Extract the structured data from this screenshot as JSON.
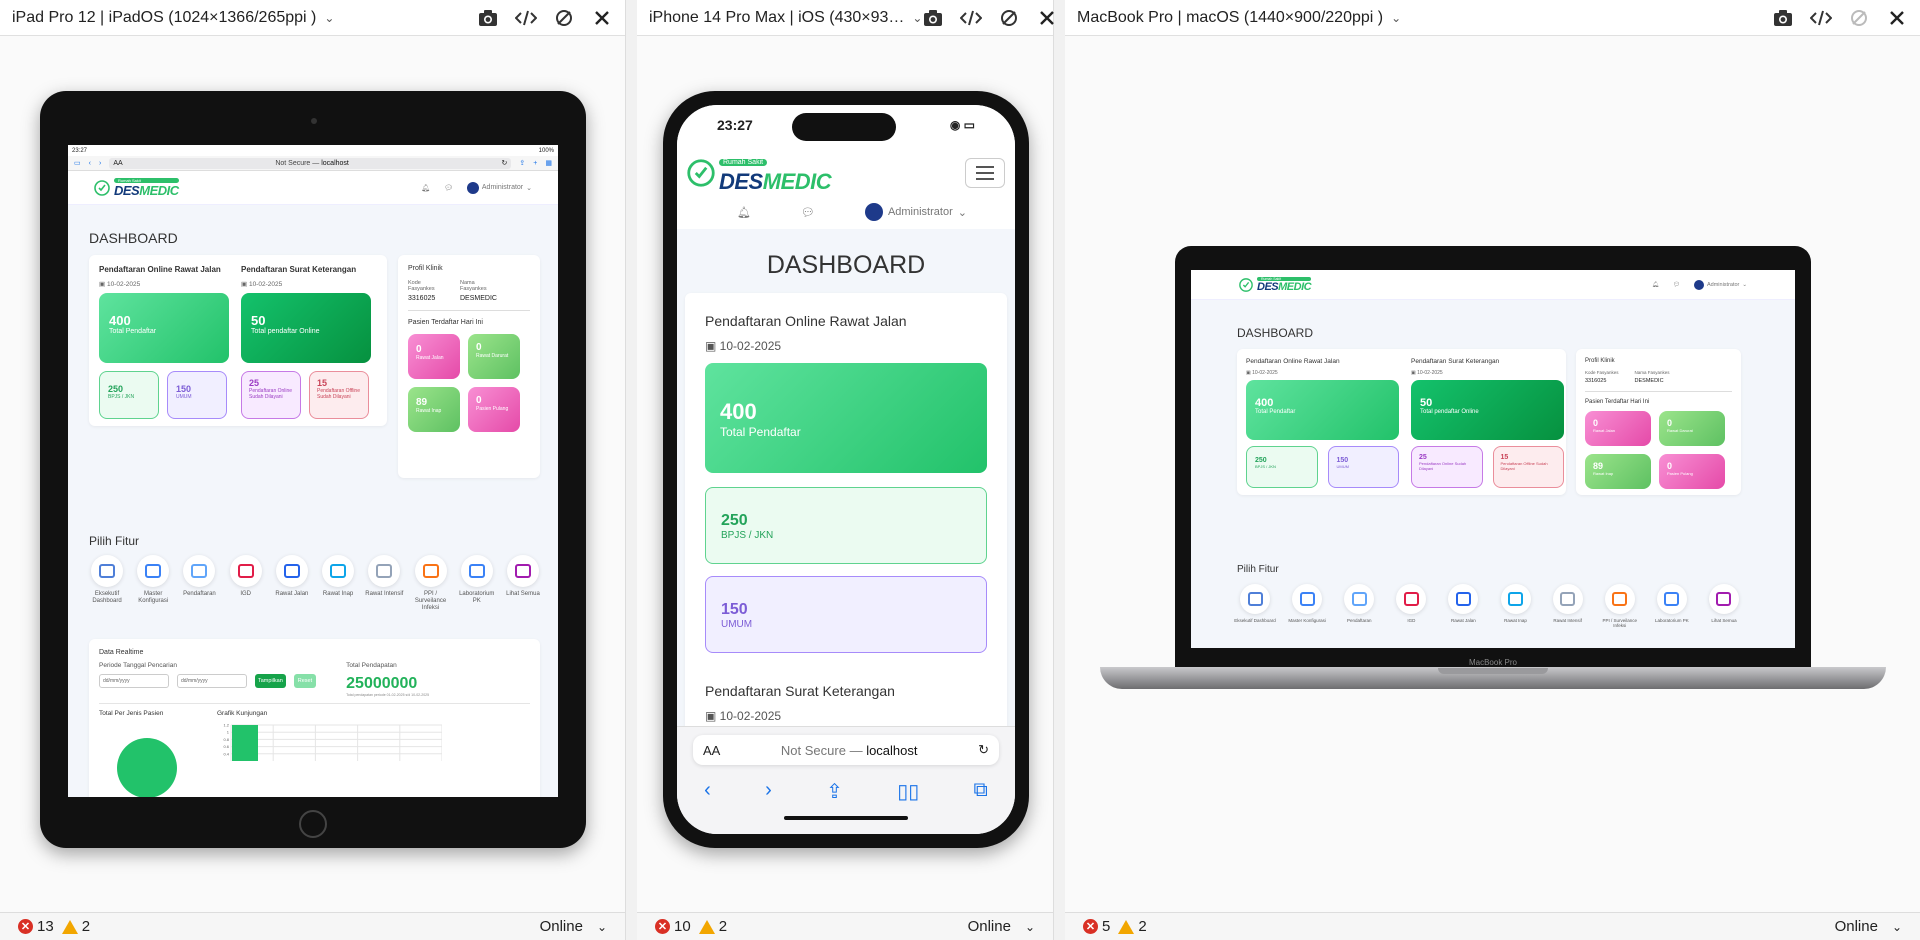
{
  "panes": [
    {
      "title": "iPad Pro 12 | iPadOS (1024×1366/265ppi )",
      "errors": "13",
      "warnings": "2",
      "status": "Online"
    },
    {
      "title": "iPhone 14 Pro Max | iOS (430×93…",
      "errors": "10",
      "warnings": "2",
      "status": "Online"
    },
    {
      "title": "MacBook Pro | macOS (1440×900/220ppi )",
      "errors": "5",
      "warnings": "2",
      "status": "Online"
    }
  ],
  "app": {
    "logo_badge": "Rumah Sakit",
    "logo_main": "DES",
    "logo_accent": "MEDIC",
    "user": "Administrator",
    "page_title": "DASHBOARD",
    "online_title": "Pendaftaran Online Rawat Jalan",
    "online_date": "10-02-2025",
    "online_total": "400",
    "online_total_label": "Total Pendaftar",
    "bpjs_value": "250",
    "bpjs_label": "BPJS / JKN",
    "umum_value": "150",
    "umum_label": "UMUM",
    "surat_title": "Pendaftaran Surat Keterangan",
    "surat_date": "10-02-2025",
    "surat_total": "50",
    "surat_total_label": "Total pendaftar Online",
    "surat_online_done": "25",
    "surat_online_done_label": "Pendaftaran Online Sudah Dilayani",
    "surat_offline_done": "15",
    "surat_offline_done_label": "Pendaftaran Offline Sudah Dilayani",
    "profil_title": "Profil Klinik",
    "kode_label": "Kode Fasyankes",
    "kode_value": "3316025",
    "nama_label": "Nama Fasyankes",
    "nama_value": "DESMEDIC",
    "pasien_title": "Pasien Terdaftar Hari Ini",
    "rawat_jalan": "0",
    "rawat_jalan_label": "Rawat Jalan",
    "rawat_darurat": "0",
    "rawat_darurat_label": "Rawat Darurat",
    "rawat_inap": "89",
    "rawat_inap_label": "Rawat Inap",
    "pasien_pulang": "0",
    "pasien_pulang_label": "Pasien Pulang",
    "fitur_title": "Pilih Fitur",
    "features": [
      "Eksekutif Dashboard",
      "Master Konfigurasi",
      "Pendaftaran",
      "IGD",
      "Rawat Jalan",
      "Rawat Inap",
      "Rawat Intensif",
      "PPI / Surveilance Infeksi",
      "Laboratorium PK",
      "Lihat Semua"
    ],
    "realtime_title": "Data Realtime",
    "periode_label": "Periode Tanggal Pencarian",
    "date_placeholder": "dd/mm/yyyy",
    "btn_tampilkan": "Tampilkan",
    "btn_reset": "Reset",
    "total_pendapatan_label": "Total Pendapatan",
    "total_pendapatan": "25000000",
    "total_pendapatan_note": "Total pendapatan periode 01-02-2025 s/d 10-02-2025",
    "jenis_pasien_title": "Total Per Jenis Pasien",
    "kunjungan_title": "Grafik Kunjungan"
  },
  "ipad_browser": {
    "time": "23:27",
    "battery": "100%",
    "aa": "AA",
    "url_prefix": "Not Secure — ",
    "url_host": "localhost"
  },
  "iphone": {
    "time": "23:27",
    "aa": "AA",
    "url_prefix": "Not Secure — ",
    "url_host": "localhost"
  },
  "macbook": {
    "brand": "MacBook Pro"
  },
  "chart_data": {
    "type": "bar",
    "title": "Grafik Kunjungan",
    "yticks": [
      "1.2",
      "1",
      "0.8",
      "0.6",
      "0.4"
    ],
    "values": [
      1.2
    ]
  }
}
